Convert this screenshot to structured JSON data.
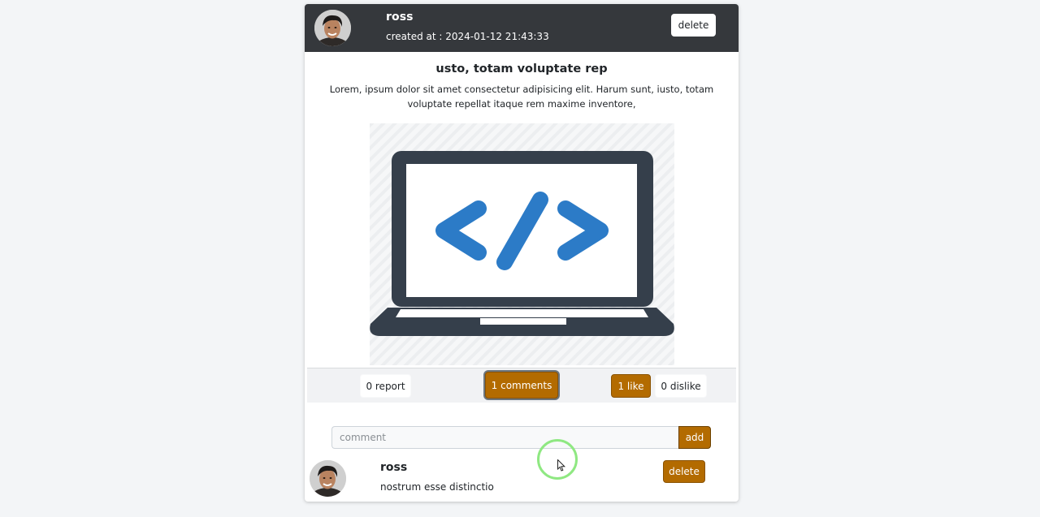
{
  "post": {
    "author": "ross",
    "created_label": "created at : 2024-01-12 21:43:33",
    "delete_label": "delete",
    "title": "usto, totam voluptate rep",
    "body": "Lorem, ipsum dolor sit amet consectetur adipisicing elit. Harum sunt, iusto, totam voluptate repellat itaque rem maxime inventore,",
    "image_icon": "laptop-code-icon"
  },
  "actions": {
    "report_label": "0 report",
    "comments_label": "1 comments",
    "like_label": "1 like",
    "dislike_label": "0 dislike"
  },
  "comment_form": {
    "placeholder": "comment",
    "value": "",
    "add_label": "add"
  },
  "comments": [
    {
      "author": "ross",
      "text": "nostrum esse distinctio",
      "delete_label": "delete"
    }
  ],
  "colors": {
    "header_bg": "#35383c",
    "accent": "#b36b00",
    "page_bg": "#f3f5f7",
    "icon_dark": "#353f4b",
    "icon_blue": "#2c7bc7"
  }
}
